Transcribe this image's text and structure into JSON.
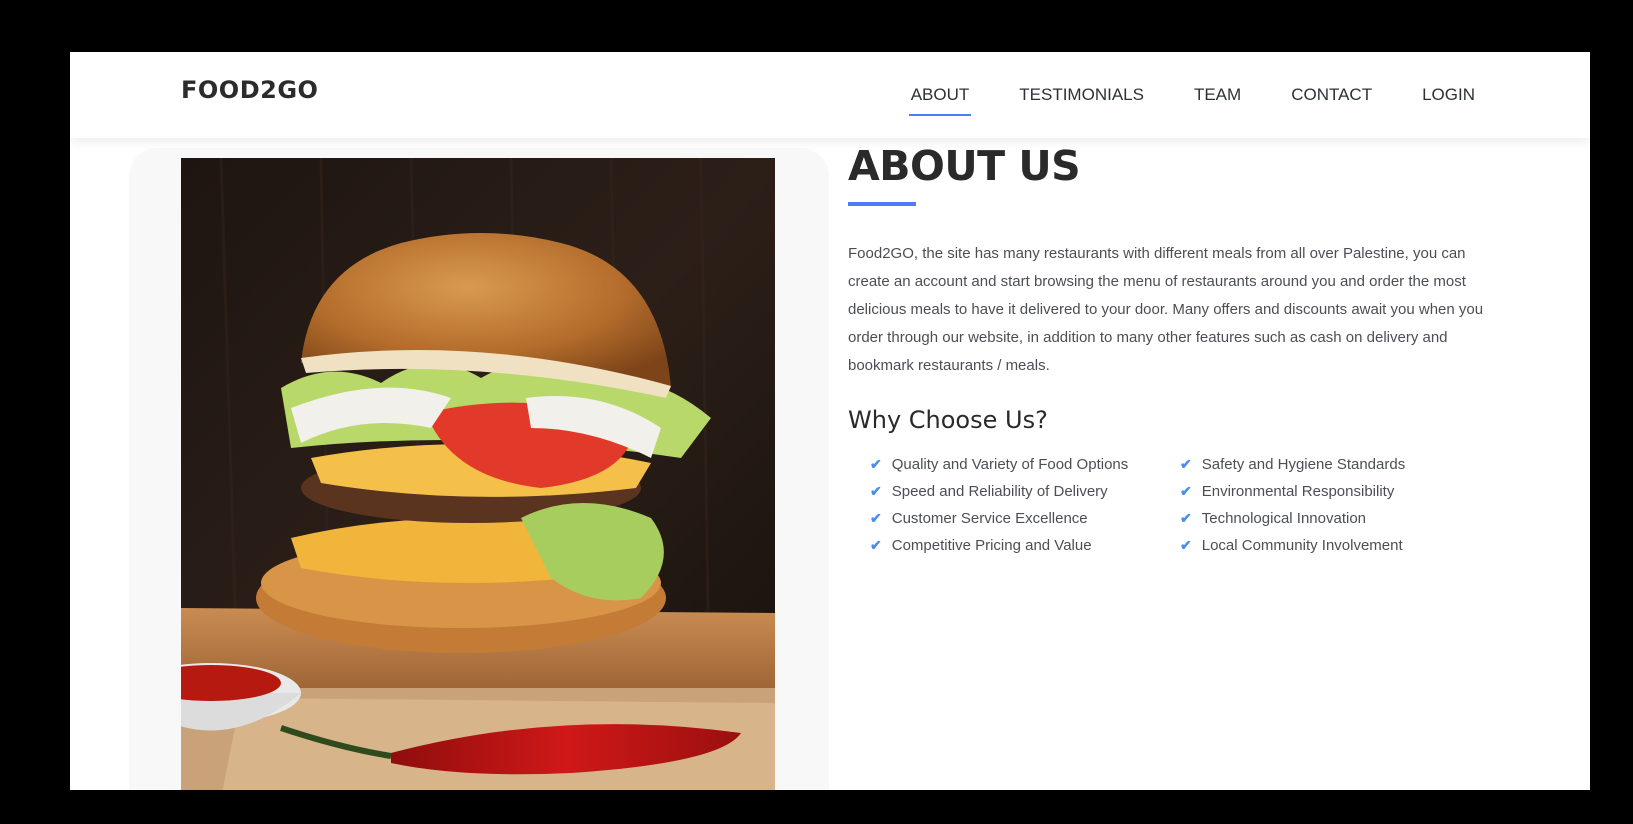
{
  "brand": "FOOD2GO",
  "nav": [
    "ABOUT",
    "TESTIMONIALS",
    "TEAM",
    "CONTACT",
    "LOGIN"
  ],
  "about": {
    "title": "ABOUT US",
    "text": "Food2GO, the site has many restaurants with different meals from all over Palestine, you can create an account and start browsing the menu of restaurants around you and order the most delicious meals to have it delivered to your door. Many offers and discounts await you when you order through our website, in addition to many other features such as cash on delivery and bookmark restaurants / meals.",
    "why_title": "Why Choose Us?",
    "features": [
      "Quality and Variety of Food Options",
      "Safety and Hygiene Standards",
      "Speed and Reliability of Delivery",
      "Environmental Responsibility",
      "Customer Service Excellence",
      "Technological Innovation",
      "Competitive Pricing and Value",
      "Local Community Involvement"
    ]
  },
  "colors": {
    "accent": "#4f7cf5",
    "check": "#4a8ee8",
    "text": "#4b4f55"
  },
  "icons": {
    "feature_icon": "check-icon",
    "image": "burger-photo"
  }
}
